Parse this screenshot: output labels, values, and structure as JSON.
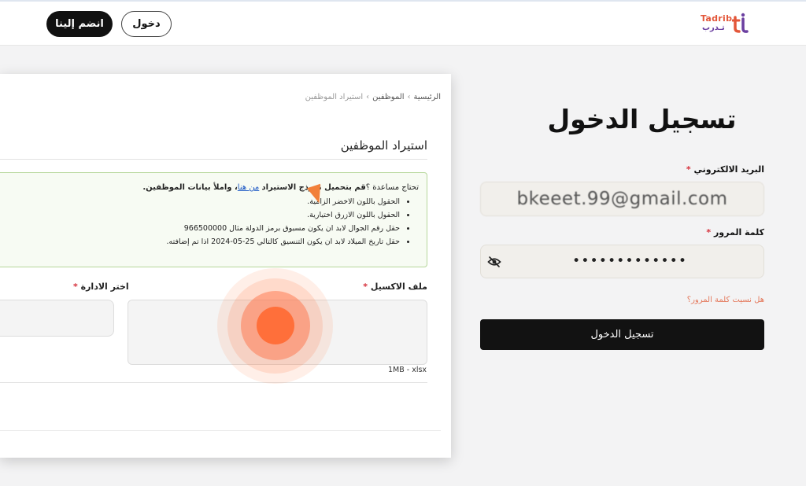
{
  "header": {
    "join_label": "انضم إلينا",
    "login_label": "دخول",
    "logo_en": "Tadrib",
    "logo_ar": "تـدرب"
  },
  "employees_card": {
    "breadcrumb": [
      "الرئيسية",
      "الموظفين",
      "استيراد الموظفين"
    ],
    "title": "استيراد الموظفين",
    "help_intro_plain": "تحتاج مساعدة ؟",
    "help_intro_bold": "قم بتحميل نموذج الاستيراد",
    "help_link": "من هنا",
    "help_intro_end": "، واملأ بيانات الموظفين.",
    "help_items": [
      "الحقول باللون الاخضر الزامية.",
      "الحقول باللون الازرق اختيارية.",
      "حقل رقم الجوال لابد ان يكون مسبوق برمز الدولة مثال 966500000",
      "حقل تاريخ الميلاد لابد ان يكون التنسيق كالتالي 25-05-2024 اذا تم إضافته."
    ],
    "excel_label": "ملف الاكسيل",
    "dept_label": "اختر الادارة",
    "file_hint": "1MB - xlsx"
  },
  "login": {
    "title": "تسجيل الدخول",
    "email_label": "البريد الالكتروني",
    "email_value": "bkeeet.99@gmail.com",
    "password_label": "كلمة المرور",
    "password_value": "•••••••••••••",
    "forgot_label": "هل نسيت كلمة المرور؟",
    "submit_label": "تسجيل الدخول"
  },
  "colors": {
    "accent_orange": "#ff6f3a",
    "brand_purple": "#6b3fa0",
    "required_red": "#d6303b"
  },
  "icons": {
    "eye": "eye-off-icon"
  }
}
